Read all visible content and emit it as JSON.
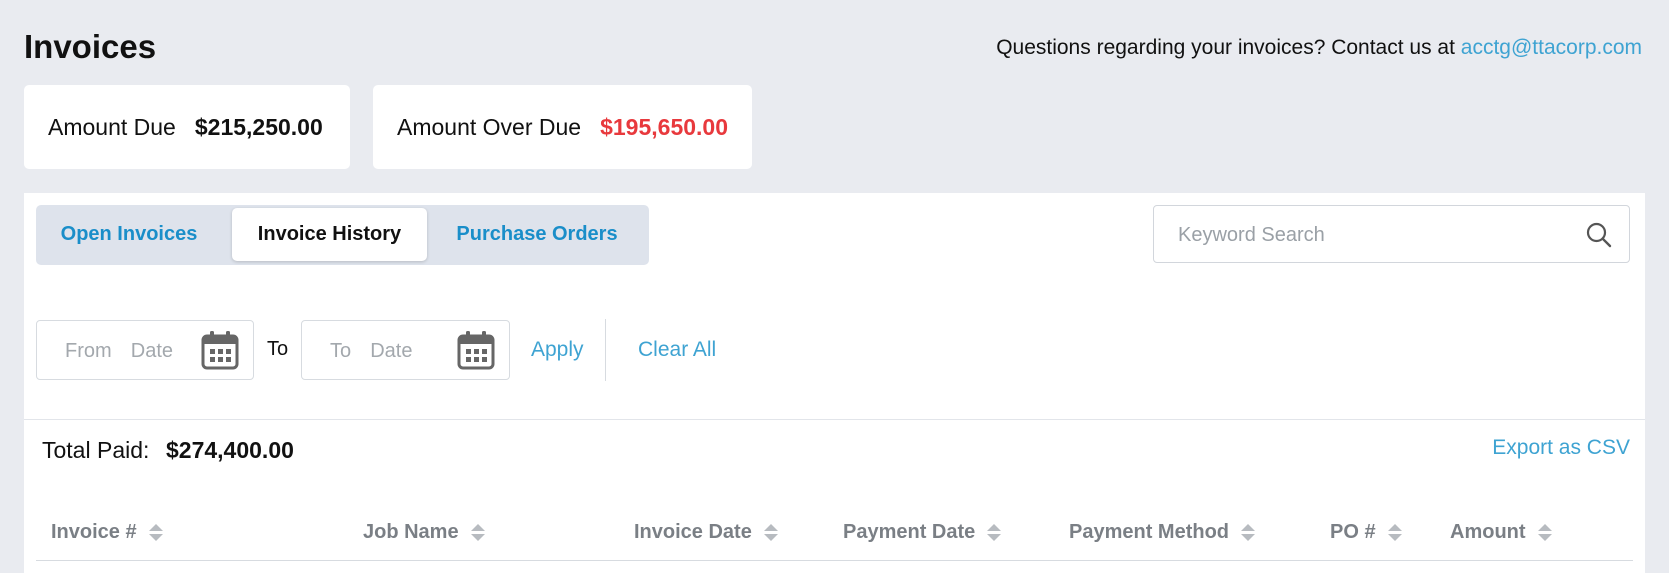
{
  "header": {
    "title": "Invoices",
    "contact_text": "Questions regarding your invoices? Contact us at",
    "contact_email": "acctg@ttacorp.com"
  },
  "summary": {
    "amount_due_label": "Amount Due",
    "amount_due_value": "$215,250.00",
    "amount_overdue_label": "Amount Over Due",
    "amount_overdue_value": "$195,650.00",
    "overdue_color": "#e8393d"
  },
  "tabs": [
    {
      "label": "Open Invoices",
      "active": false
    },
    {
      "label": "Invoice History",
      "active": true
    },
    {
      "label": "Purchase Orders",
      "active": false
    }
  ],
  "search": {
    "placeholder": "Keyword Search",
    "icon": "search-icon"
  },
  "filters": {
    "from_placeholder": "From  Date",
    "to_label": "To",
    "to_placeholder": "To  Date",
    "calendar_icon": "calendar-icon",
    "apply_label": "Apply",
    "clear_label": "Clear All"
  },
  "totals": {
    "label": "Total Paid:",
    "value": "$274,400.00",
    "export_label": "Export as CSV"
  },
  "table": {
    "columns": [
      "Invoice #",
      "Job Name",
      "Invoice Date",
      "Payment Date",
      "Payment Method",
      "PO #",
      "Amount"
    ],
    "sort_icon": "sort-icon"
  },
  "colors": {
    "accent": "#3ea3d2",
    "tab_link": "#1a8ec9",
    "background": "#e9ebf0"
  }
}
